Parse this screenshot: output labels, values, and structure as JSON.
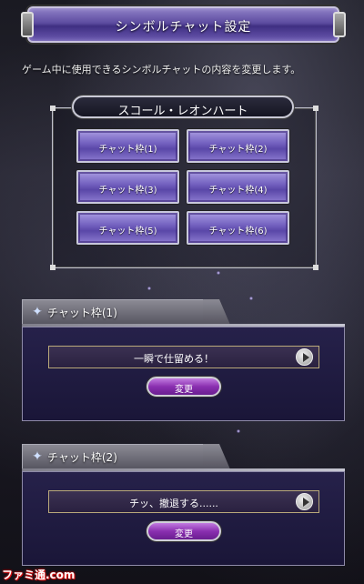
{
  "header": {
    "title": "シンボルチャット設定"
  },
  "description": "ゲーム中に使用できるシンボルチャットの内容を変更します。",
  "character": {
    "name": "スコール・レオンハート",
    "slots": [
      {
        "label": "チャット枠(1)"
      },
      {
        "label": "チャット枠(2)"
      },
      {
        "label": "チャット枠(3)"
      },
      {
        "label": "チャット枠(4)"
      },
      {
        "label": "チャット枠(5)"
      },
      {
        "label": "チャット枠(6)"
      }
    ]
  },
  "sections": [
    {
      "title": "チャット枠(1)",
      "message": "一瞬で仕留める！",
      "change_label": "変更"
    },
    {
      "title": "チャット枠(2)",
      "message": "チッ、撤退する......",
      "change_label": "変更"
    }
  ],
  "logo": "ファミ通.com",
  "colors": {
    "accent_purple": "#5d4ca0",
    "button_purple": "#8a2fb0"
  }
}
